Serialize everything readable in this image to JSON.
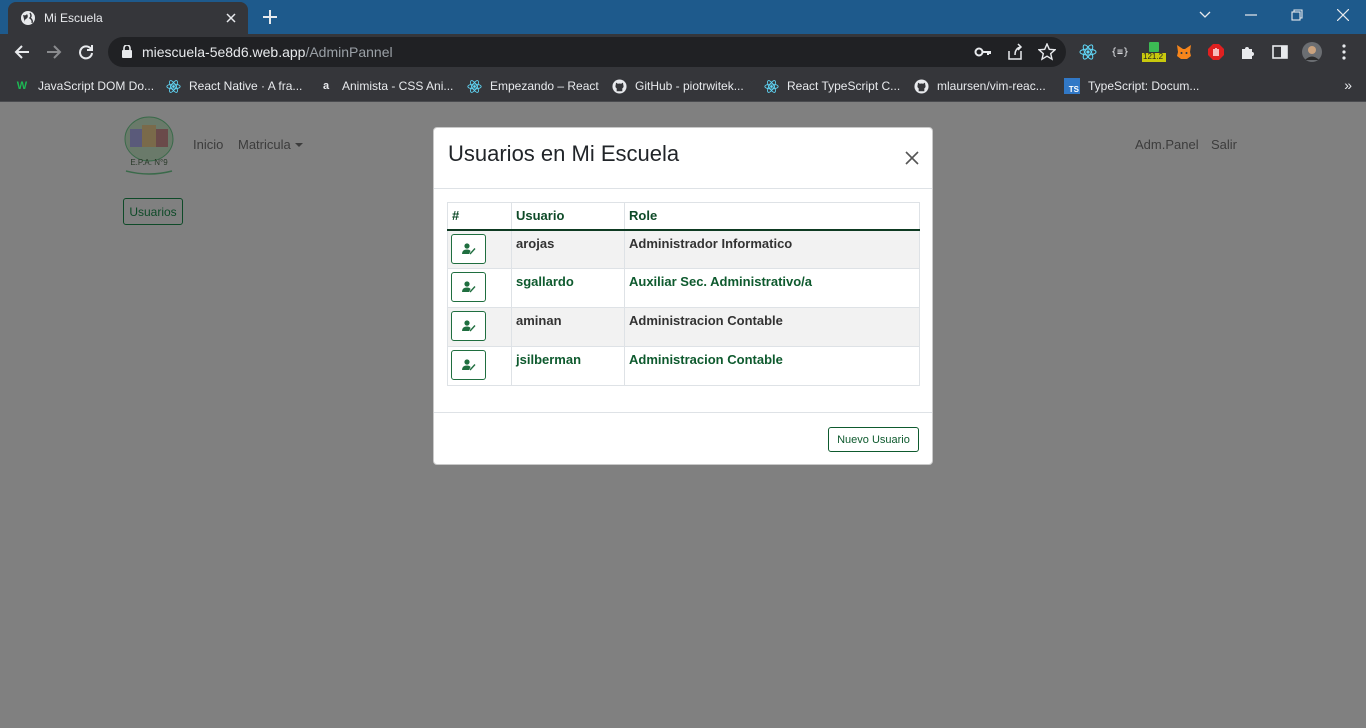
{
  "browser": {
    "tab_title": "Mi Escuela",
    "url_host": "miescuela-5e8d6.web.app",
    "url_path": "/AdminPannel",
    "extension_badge": "121.2",
    "bookmarks": [
      {
        "label": "JavaScript DOM Do...",
        "icon": "w-icon",
        "icon_text": "W",
        "icon_color": "#1db954"
      },
      {
        "label": "React Native · A fra...",
        "icon": "react-icon",
        "icon_text": "",
        "icon_color": "#61dafb"
      },
      {
        "label": "Animista - CSS Ani...",
        "icon": "a-icon",
        "icon_text": "a",
        "icon_color": "#e8eaed"
      },
      {
        "label": "Empezando – React",
        "icon": "react-icon",
        "icon_text": "",
        "icon_color": "#61dafb"
      },
      {
        "label": "GitHub - piotrwitek...",
        "icon": "github-icon",
        "icon_text": "",
        "icon_color": "#e8eaed"
      },
      {
        "label": "React TypeScript C...",
        "icon": "cheatsheet-icon",
        "icon_text": "",
        "icon_color": "#61dafb"
      },
      {
        "label": "mlaursen/vim-reac...",
        "icon": "github-icon",
        "icon_text": "",
        "icon_color": "#e8eaed"
      },
      {
        "label": "TypeScript: Docum...",
        "icon": "ts-icon",
        "icon_text": "TS",
        "icon_color": "#3178c6"
      }
    ]
  },
  "nav": {
    "logo_text": "E.P.A. N°9",
    "inicio": "Inicio",
    "matricula": "Matricula",
    "adm_panel": "Adm.Panel",
    "salir": "Salir"
  },
  "page": {
    "usuarios_button": "Usuarios"
  },
  "modal": {
    "title": "Usuarios en Mi Escuela",
    "columns": {
      "num": "#",
      "usuario": "Usuario",
      "role": "Role"
    },
    "rows": [
      {
        "usuario": "arojas",
        "role": "Administrador Informatico"
      },
      {
        "usuario": "sgallardo",
        "role": "Auxiliar Sec. Administrativo/a"
      },
      {
        "usuario": "aminan",
        "role": "Administracion Contable"
      },
      {
        "usuario": "jsilberman",
        "role": "Administracion Contable"
      }
    ],
    "new_user_button": "Nuevo Usuario"
  },
  "colors": {
    "tabbar": "#1e5a8c",
    "chrome": "#35363a",
    "overlay": "#808080",
    "accent_green": "#0e5a2e"
  }
}
